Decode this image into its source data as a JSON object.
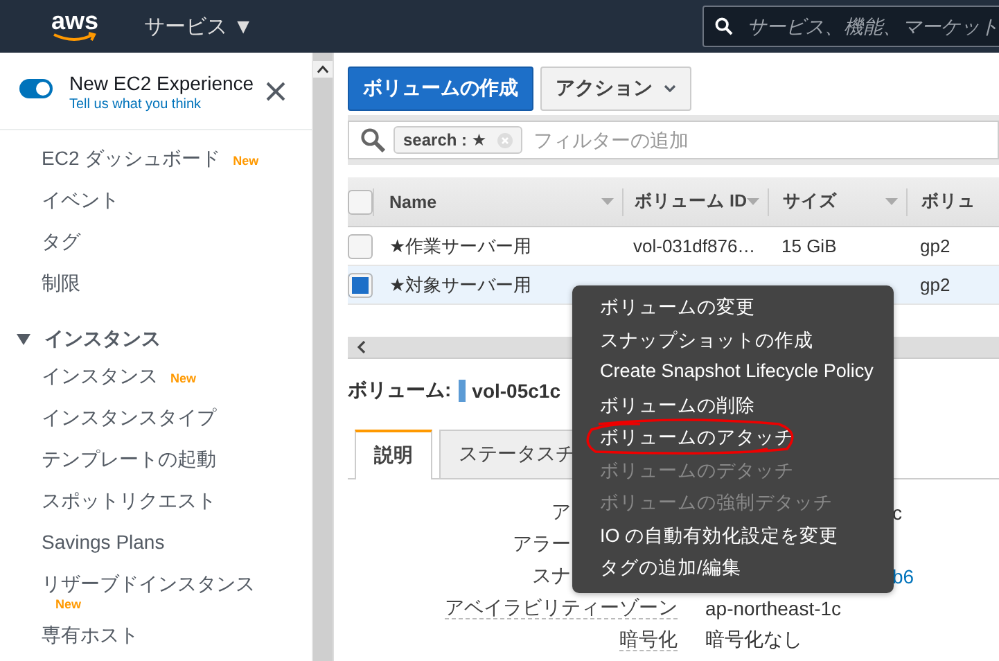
{
  "topbar": {
    "logo": "aws",
    "services": "サービス ▼",
    "search": {
      "placeholder": "サービス、機能、マーケット"
    }
  },
  "sidebar": {
    "experience": {
      "label": "New EC2 Experience",
      "on": true,
      "link": "Tell us what you think"
    },
    "items": [
      {
        "kind": "item",
        "label": "EC2 ダッシュボード",
        "badge": "New"
      },
      {
        "kind": "item",
        "label": "イベント"
      },
      {
        "kind": "item",
        "label": "タグ"
      },
      {
        "kind": "item",
        "label": "制限"
      },
      {
        "kind": "section",
        "label": "インスタンス",
        "expanded": true
      },
      {
        "kind": "item",
        "label": "インスタンス",
        "badge": "New"
      },
      {
        "kind": "item",
        "label": "インスタンスタイプ"
      },
      {
        "kind": "item",
        "label": "テンプレートの起動"
      },
      {
        "kind": "item",
        "label": "スポットリクエスト"
      },
      {
        "kind": "item",
        "label": "Savings Plans"
      },
      {
        "kind": "item",
        "label": "リザーブドインスタンス",
        "badge": "New"
      },
      {
        "kind": "item",
        "label": "専有ホスト"
      }
    ]
  },
  "toolbar": {
    "create": "ボリュームの作成",
    "actions": "アクション"
  },
  "filter": {
    "token": "search : ★",
    "placeholder": "フィルターの追加"
  },
  "table": {
    "select_all": {
      "checked": false
    },
    "columns": [
      "Name",
      "ボリューム ID",
      "サイズ",
      "ボリュ"
    ],
    "rows": [
      {
        "selected": false,
        "cells": [
          "★作業サーバー用",
          "vol-031df876…",
          "15 GiB",
          "gp2"
        ]
      },
      {
        "selected": true,
        "cells": [
          "★対象サーバー用",
          "",
          "",
          "gp2"
        ]
      }
    ]
  },
  "detail": {
    "label": "ボリューム:",
    "volume": "vol-05c1c",
    "tabs": [
      {
        "label": "説明",
        "selected": true
      },
      {
        "label": "ステータスチ",
        "selected": false
      }
    ],
    "rows": [
      {
        "label": "ア",
        "value": "c",
        "covered": true
      },
      {
        "label": "アラー",
        "value": "",
        "covered": true
      },
      {
        "label": "スナ",
        "value": "b6",
        "covered": true,
        "link": true
      },
      {
        "label": "アベイラビリティーゾーン",
        "value": "ap-northeast-1c",
        "covered": false
      },
      {
        "label": "暗号化",
        "value": "暗号化なし",
        "covered": false
      }
    ]
  },
  "context_menu": {
    "items": [
      {
        "label": "ボリュームの変更",
        "disabled": false,
        "circled": false
      },
      {
        "label": "スナップショットの作成",
        "disabled": false,
        "circled": false
      },
      {
        "label": "Create Snapshot Lifecycle Policy",
        "disabled": false,
        "circled": false
      },
      {
        "label": "ボリュームの削除",
        "disabled": false,
        "circled": false
      },
      {
        "label": "ボリュームのアタッチ",
        "disabled": false,
        "circled": true
      },
      {
        "label": "ボリュームのデタッチ",
        "disabled": true,
        "circled": false
      },
      {
        "label": "ボリュームの強制デタッチ",
        "disabled": true,
        "circled": false
      },
      {
        "label": "IO の自動有効化設定を変更",
        "disabled": false,
        "circled": false
      },
      {
        "label": "タグの追加/編集",
        "disabled": false,
        "circled": false
      }
    ]
  }
}
